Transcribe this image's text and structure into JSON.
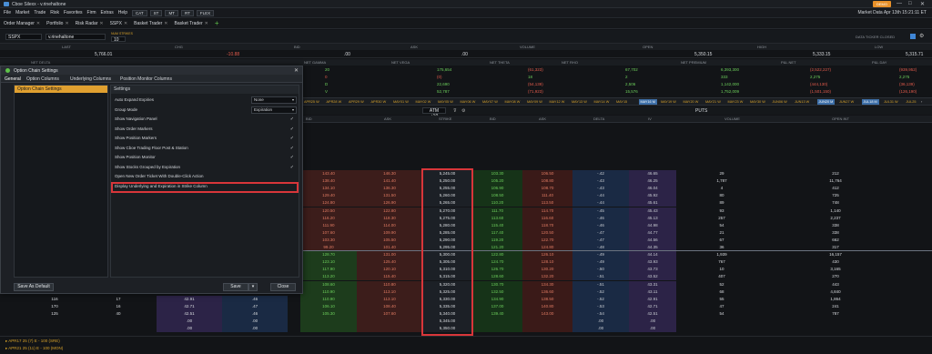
{
  "titlebar": {
    "title": "Cboe Silexx - v.rinehaltone",
    "badge": "DEMO",
    "window_controls": [
      "—",
      "□",
      "✕"
    ]
  },
  "menubar": {
    "items": [
      "File",
      "Market",
      "Trade",
      "Risk",
      "Favorites",
      "Firm",
      "Extras",
      "Help"
    ],
    "buttons": [
      "CAT",
      "ST",
      "MT",
      "RT",
      "FLEX"
    ],
    "right_text": "Market Data   Apr 13th 15:21:11 ET"
  },
  "tabbar": {
    "tabs": [
      "Order Manager",
      "Portfolio",
      "Risk Radar",
      "SSPX",
      "Basket Trader",
      "Basket Trader"
    ],
    "plus": "+"
  },
  "symbar": {
    "symbol": "SSPX",
    "account": "v.rinehaltone",
    "qty_label": "NUM STRIKES",
    "qty": "10",
    "right_label": "DATA TICKER CLOSED"
  },
  "quote": {
    "headers": [
      "LAST",
      "CHG",
      "BID",
      "ASK",
      "VOLUME",
      "OPEN",
      "HIGH",
      "LOW"
    ],
    "values": [
      "5,766.01",
      "-10.88",
      ".00",
      ".00",
      "",
      "5,350.15",
      "5,333.15",
      "5,315.71"
    ]
  },
  "greeks": {
    "headers": [
      "NET DELTA",
      "NET GAMMA",
      "NET VEGA",
      "NET THETA",
      "NET RHO",
      "NET PREMIUM",
      "P&L NET",
      "P&L DAY"
    ],
    "rows": [
      [
        "20",
        "175,654",
        "(61,323)",
        "67,702",
        "6,393,300",
        "(2,522,227)",
        "(939,952)"
      ],
      [
        "0",
        "(0)",
        "18",
        "2",
        "333",
        "2,275",
        "2,275"
      ],
      [
        "D",
        "22,690",
        "(54,139)",
        "2,506",
        "1,142,000",
        "(444,130)",
        "(36,139)"
      ],
      [
        "V",
        "52,787",
        "(71,923)",
        "15,576",
        "1,752,009",
        "(1,501,150)",
        "(126,190)"
      ]
    ]
  },
  "expirations": [
    "APR25 W",
    "APR28 W",
    "APR29 W",
    "APR30 W",
    "MAY01 W",
    "MAY02 W",
    "MAY05 W",
    "MAY06 W",
    "MAY07 W",
    "MAY08 W",
    "MAY09 W",
    "MAY12 W",
    "MAY13 W",
    "MAY14 W",
    "MAY15",
    "MAY16 M",
    "MAY19 W",
    "MAY20 W",
    "MAY21 W",
    "MAY23 W",
    "MAY30 W",
    "JUN06 W",
    "JUN13 W",
    "JUN20 M",
    "JUN27 W",
    "JUL18 M",
    "JUL31 W",
    "JUL25"
  ],
  "chain_header": {
    "atm": "ATM +10",
    "puts": "PUTS"
  },
  "chain_columns": [
    "BID",
    "ASK",
    "STRIKE",
    "BID",
    "ASK",
    "DELTA",
    "IV",
    "VOLUME",
    "OPEN INT"
  ],
  "chain": [
    [
      "143.40",
      "146.30",
      "5,245.00",
      "103.30",
      "106.50",
      "-.42",
      "46.65",
      "29",
      "212"
    ],
    [
      "138.40",
      "141.40",
      "5,250.00",
      "105.20",
      "108.80",
      "-.43",
      "46.25",
      "1,787",
      "11,764"
    ],
    [
      "134.10",
      "136.30",
      "5,255.00",
      "106.90",
      "108.70",
      "-.43",
      "46.04",
      "4",
      "412"
    ],
    [
      "129.40",
      "131.50",
      "5,260.00",
      "108.50",
      "111.40",
      "-.44",
      "45.92",
      "80",
      "725"
    ],
    [
      "124.80",
      "126.90",
      "5,265.00",
      "110.20",
      "113.50",
      "-.44",
      "45.61",
      "89",
      "748"
    ],
    [
      "120.50",
      "122.80",
      "5,270.00",
      "111.70",
      "114.70",
      "-.45",
      "45.43",
      "93",
      "1,140"
    ],
    [
      "116.20",
      "118.30",
      "5,275.00",
      "113.60",
      "116.60",
      "-.46",
      "45.13",
      "257",
      "2,237"
    ],
    [
      "111.90",
      "114.00",
      "5,280.00",
      "115.40",
      "118.70",
      "-.46",
      "44.98",
      "54",
      "338"
    ],
    [
      "107.60",
      "109.90",
      "5,285.00",
      "117.40",
      "120.50",
      "-.47",
      "44.77",
      "21",
      "338"
    ],
    [
      "103.30",
      "105.50",
      "5,290.00",
      "119.20",
      "122.70",
      "-.47",
      "44.56",
      "67",
      "662"
    ],
    [
      "99.20",
      "101.40",
      "5,295.00",
      "121.20",
      "124.80",
      "-.48",
      "44.35",
      "36",
      "317"
    ],
    [
      "128.70",
      "131.00",
      "5,300.00",
      "122.80",
      "126.10",
      "-.49",
      "44.14",
      "1,939",
      "16,157"
    ],
    [
      "123.10",
      "125.40",
      "5,305.00",
      "124.70",
      "128.10",
      "-.49",
      "43.93",
      "767",
      "430"
    ],
    [
      "117.90",
      "120.10",
      "5,310.00",
      "126.70",
      "130.20",
      "-.50",
      "43.73",
      "10",
      "3,165"
    ],
    [
      "113.20",
      "115.40",
      "5,315.00",
      "128.60",
      "132.20",
      "-.51",
      "43.52",
      "407",
      "270"
    ],
    [
      "108.60",
      "110.80",
      "5,320.00",
      "130.70",
      "134.30",
      "-.51",
      "43.31",
      "52",
      "443"
    ],
    [
      "110.90",
      "113.10",
      "5,325.00",
      "132.50",
      "136.60",
      "-.52",
      "43.11",
      "68",
      "4,840"
    ],
    [
      "110.90",
      "113.10",
      "5,330.00",
      "134.90",
      "138.50",
      "-.52",
      "42.91",
      "55",
      "1,864"
    ],
    [
      "106.10",
      "108.40",
      "5,335.00",
      "137.00",
      "140.80",
      "-.53",
      "42.71",
      "47",
      "241"
    ],
    [
      "105.30",
      "107.60",
      "5,340.00",
      "139.40",
      "143.00",
      "-.54",
      "42.51",
      "54",
      "787"
    ],
    [
      "",
      "",
      "5,345.00",
      "",
      "",
      ".00",
      ".00",
      "",
      ""
    ],
    [
      "",
      "",
      "5,350.00",
      "",
      "",
      ".00",
      ".00",
      "",
      ""
    ]
  ],
  "lower_left": [
    [
      "116",
      "17",
      "42.91",
      ".46"
    ],
    [
      "170",
      "16",
      "42.71",
      ".47"
    ],
    [
      "125",
      "40",
      "42.51",
      ".46"
    ],
    [
      "",
      "",
      ".00",
      ".00"
    ],
    [
      "",
      "",
      ".00",
      ".00"
    ]
  ],
  "dialog": {
    "title": "Option Chain Settings",
    "tabs": [
      "General",
      "Option Columns",
      "Underlying Columns",
      "Position Monitor Columns"
    ],
    "left_item": "Option Chain Settings",
    "settings_head": "Settings",
    "settings": [
      {
        "label": "Auto Expand Expiries",
        "value": "None",
        "type": "select"
      },
      {
        "label": "Group Mode",
        "value": "Expiration",
        "type": "select"
      },
      {
        "label": "Show Navigation Panel",
        "value": "✓",
        "type": "check"
      },
      {
        "label": "Show Order Markers",
        "value": "✓",
        "type": "check"
      },
      {
        "label": "Show Position Markers",
        "value": "✓",
        "type": "check"
      },
      {
        "label": "Show Cboe Trading Floor Post & Station",
        "value": "✓",
        "type": "check"
      },
      {
        "label": "Show Position Monitor",
        "value": "✓",
        "type": "check"
      },
      {
        "label": "Show Stocks Grouped by Expiration",
        "value": "✓",
        "type": "check"
      },
      {
        "label": "Open New Order Ticket With Double-Click Action",
        "value": "",
        "type": "check"
      },
      {
        "label": "Display Underlying and Expiration in Strike Column",
        "value": "",
        "type": "check"
      }
    ],
    "save_default": "Save As Default",
    "save": "Save",
    "close": "Close"
  },
  "status_rows": [
    "▸ APR17 25 (7) E - 100 (SRE)",
    "▸ APR21 25 (11) E - 100 (MON)"
  ]
}
